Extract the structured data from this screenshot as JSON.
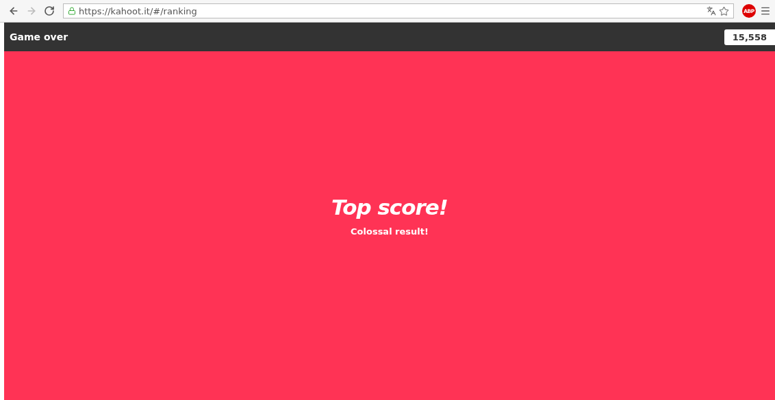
{
  "browser": {
    "nav": [
      {
        "kind": "back",
        "disabled": false
      },
      {
        "kind": "forward",
        "disabled": true
      },
      {
        "kind": "reload",
        "disabled": false
      }
    ],
    "url": "https://kahoot.it/#/ranking",
    "secure": true,
    "extension_label": "ABP"
  },
  "header": {
    "title": "Game over",
    "score": "15,558"
  },
  "result": {
    "title": "Top score!",
    "subtitle": "Colossal result!"
  }
}
